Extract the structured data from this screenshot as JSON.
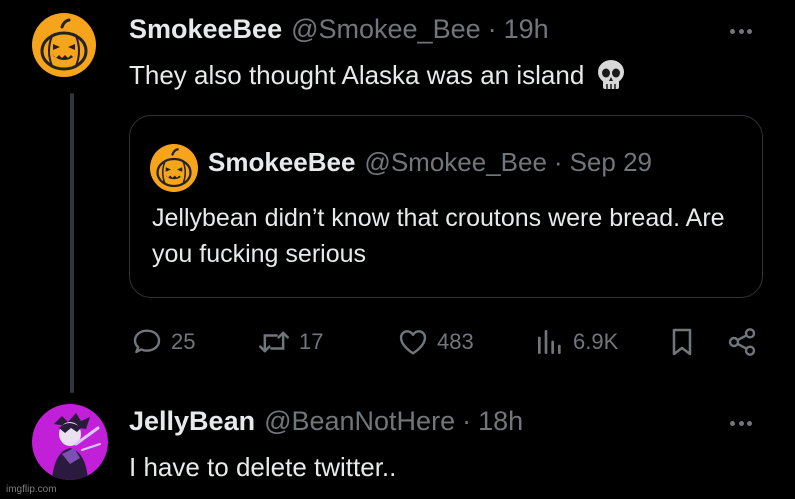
{
  "tweet": {
    "author_name": "SmokeeBee",
    "handle": "@Smokee_Bee",
    "separator": "·",
    "time": "19h",
    "text": "They also thought Alaska was an island",
    "emoji": "skull"
  },
  "quoted_tweet": {
    "author_name": "SmokeeBee",
    "handle": "@Smokee_Bee",
    "separator": "·",
    "time": "Sep 29",
    "text": "Jellybean didn’t know that croutons were bread. Are you fucking serious"
  },
  "actions": {
    "replies": "25",
    "reposts": "17",
    "likes": "483",
    "views": "6.9K"
  },
  "reply": {
    "author_name": "JellyBean",
    "handle": "@BeanNotHere",
    "separator": "·",
    "time": "18h",
    "text": "I have to delete twitter.."
  },
  "watermark": "imgflip.com",
  "colors": {
    "background": "#000000",
    "text": "#e7e9ea",
    "muted": "#71767b",
    "border": "#2f3336",
    "pumpkin": "#f5a020",
    "avatar2_bg": "#c11fd6"
  }
}
